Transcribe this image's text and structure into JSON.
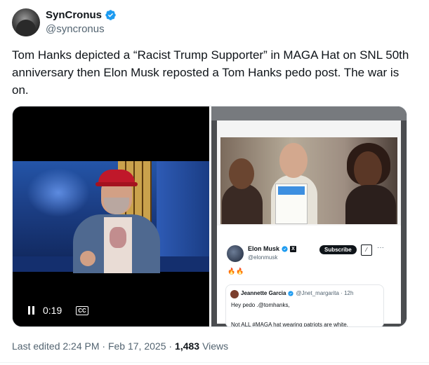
{
  "author": {
    "display_name": "SynCronus",
    "handle": "@syncronus"
  },
  "tweet": {
    "text": "Tom Hanks depicted a “Racist Trump Supporter” in MAGA Hat on SNL 50th anniversary then Elon Musk reposted a Tom Hanks pedo post. The war is on."
  },
  "video": {
    "time": "0:19",
    "cc_label": "CC"
  },
  "embedded_post": {
    "name": "Elon Musk",
    "handle": "@elonmusk",
    "subscribe_label": "Subscribe",
    "emoji": "🔥🔥",
    "quote": {
      "name": "Jeannette Garcia",
      "handle": "@Jnet_margarita · 12h",
      "line1": "Hey pedo .@tomhanks,",
      "line2": "Not ALL #MAGA hat wearing patriots are white."
    }
  },
  "meta": {
    "edited": "Last edited 2:24 PM · Feb 17, 2025 ·",
    "views_count": "1,483",
    "views_label": "Views"
  },
  "colors": {
    "verified": "#1d9bf0",
    "text": "#0f1419",
    "secondary": "#536471"
  }
}
